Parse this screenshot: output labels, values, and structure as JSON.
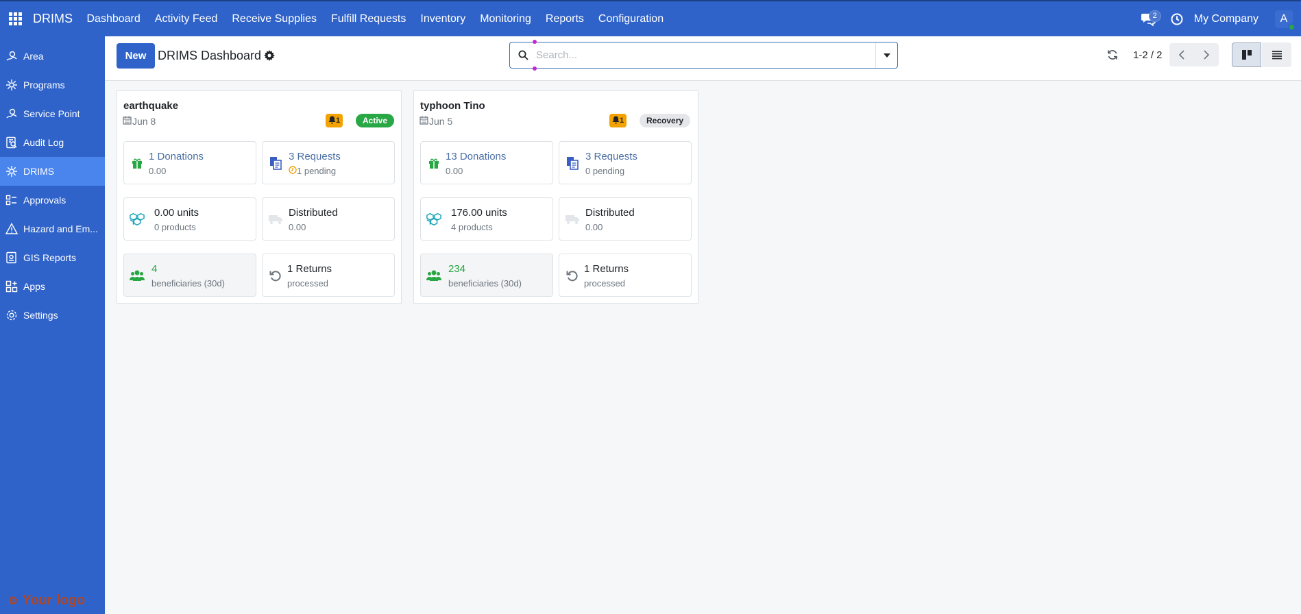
{
  "navbar": {
    "brand": "DRIMS",
    "menu": [
      "Dashboard",
      "Activity Feed",
      "Receive Supplies",
      "Fulfill Requests",
      "Inventory",
      "Monitoring",
      "Reports",
      "Configuration"
    ],
    "chat_count": "2",
    "company": "My Company",
    "avatar_letter": "A"
  },
  "sidebar": {
    "items": [
      {
        "label": "Area",
        "icon": "area-icon"
      },
      {
        "label": "Programs",
        "icon": "programs-icon"
      },
      {
        "label": "Service Point",
        "icon": "service-point-icon"
      },
      {
        "label": "Audit Log",
        "icon": "audit-log-icon"
      },
      {
        "label": "DRIMS",
        "icon": "drims-icon"
      },
      {
        "label": "Approvals",
        "icon": "approvals-icon"
      },
      {
        "label": "Hazard and Em...",
        "icon": "hazard-icon"
      },
      {
        "label": "GIS Reports",
        "icon": "gis-reports-icon"
      },
      {
        "label": "Apps",
        "icon": "apps-icon"
      },
      {
        "label": "Settings",
        "icon": "settings-icon"
      }
    ],
    "active": "DRIMS",
    "logo_text": "Your logo"
  },
  "control": {
    "new_label": "New",
    "title": "DRIMS Dashboard",
    "search_placeholder": "Search...",
    "pager": "1-2 / 2"
  },
  "cards": [
    {
      "title": "earthquake",
      "date": "Jun 8",
      "alerts": "1",
      "status": "Active",
      "donations": {
        "main": "1 Donations",
        "sub": "0.00"
      },
      "requests": {
        "main": "3 Requests",
        "sub": "1 pending"
      },
      "stock": {
        "main": "0.00 units",
        "sub": "0 products"
      },
      "distributed": {
        "main": "Distributed",
        "sub": "0.00"
      },
      "beneficiaries": {
        "main": "4",
        "sub": "beneficiaries (30d)"
      },
      "returns": {
        "main": "1 Returns",
        "sub": "processed"
      }
    },
    {
      "title": "typhoon Tino",
      "date": "Jun 5",
      "alerts": "1",
      "status": "Recovery",
      "donations": {
        "main": "13 Donations",
        "sub": "0.00"
      },
      "requests": {
        "main": "3 Requests",
        "sub": "0 pending"
      },
      "stock": {
        "main": "176.00 units",
        "sub": "4 products"
      },
      "distributed": {
        "main": "Distributed",
        "sub": "0.00"
      },
      "beneficiaries": {
        "main": "234",
        "sub": "beneficiaries (30d)"
      },
      "returns": {
        "main": "1 Returns",
        "sub": "processed"
      }
    }
  ],
  "colors": {
    "primary": "#2f63c9",
    "sidebar_active": "#4a85ee",
    "warning": "#f4a200",
    "success": "#28a745",
    "link": "#4a6fa5"
  }
}
